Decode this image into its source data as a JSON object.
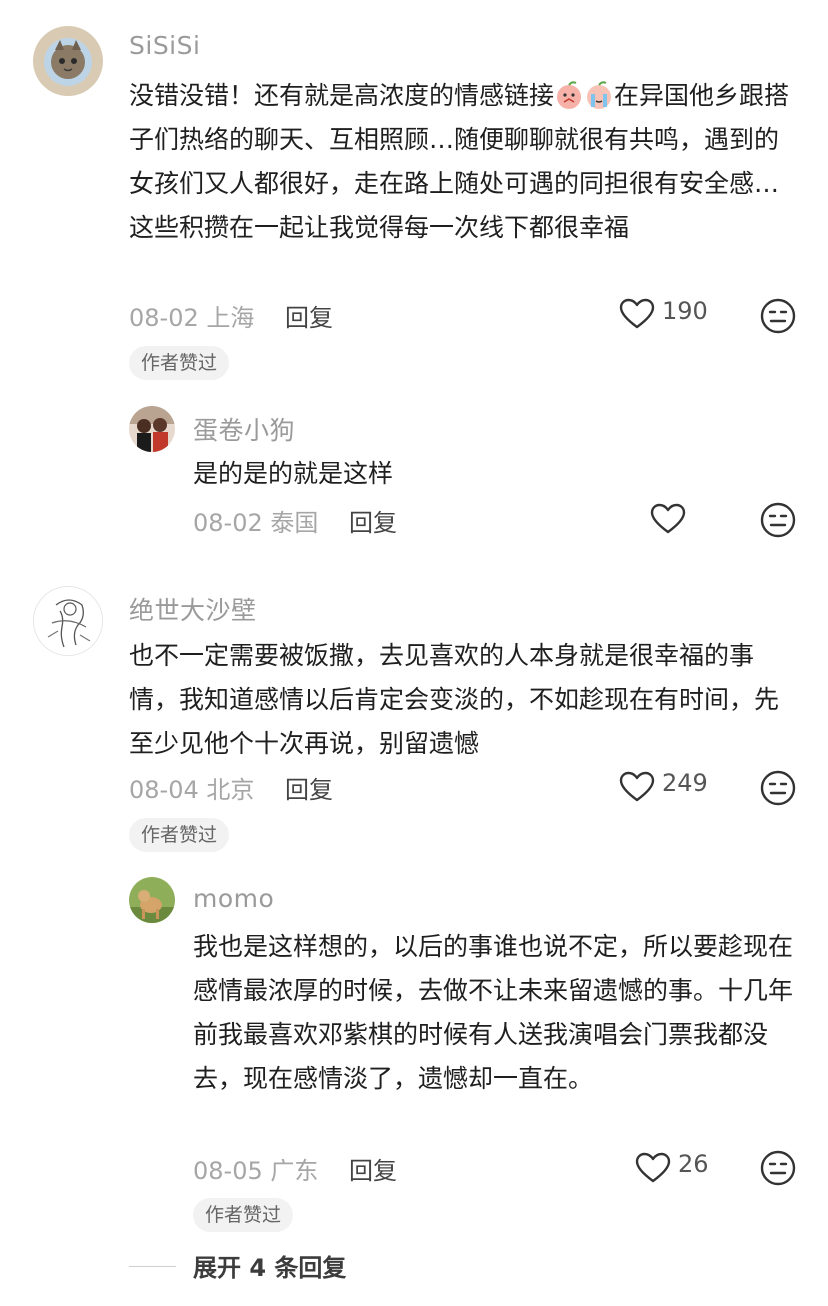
{
  "comments": [
    {
      "user": "SiSiSi",
      "text_part1": "没错没错！还有就是高浓度的情感链接",
      "text_part2": "在异国他乡跟搭子们热络的聊天、互相照顾…随便聊聊就很有共鸣，遇到的女孩们又人都很好，走在路上随处可遇的同担很有安全感…这些积攒在一起让我觉得每一次线下都很幸福",
      "date": "08-02",
      "location": "上海",
      "reply_label": "回复",
      "likes": "190",
      "badge": "作者赞过",
      "replies": [
        {
          "user": "蛋卷小狗",
          "text": "是的是的就是这样",
          "date": "08-02",
          "location": "泰国",
          "reply_label": "回复"
        }
      ]
    },
    {
      "user": "绝世大沙壁",
      "text": "也不一定需要被饭撒，去见喜欢的人本身就是很幸福的事情，我知道感情以后肯定会变淡的，不如趁现在有时间，先至少见他个十次再说，别留遗憾",
      "date": "08-04",
      "location": "北京",
      "reply_label": "回复",
      "likes": "249",
      "badge": "作者赞过",
      "replies": [
        {
          "user": "momo",
          "text": "我也是这样想的，以后的事谁也说不定，所以要趁现在感情最浓厚的时候，去做不让未来留遗憾的事。十几年前我最喜欢邓紫棋的时候有人送我演唱会门票我都没去，现在感情淡了，遗憾却一直在。",
          "date": "08-05",
          "location": "广东",
          "reply_label": "回复",
          "likes": "26",
          "badge": "作者赞过"
        }
      ],
      "expand_label": "展开 4 条回复"
    }
  ],
  "icons": {
    "like": "heart-outline-icon",
    "dislike": "neutral-face-icon"
  }
}
